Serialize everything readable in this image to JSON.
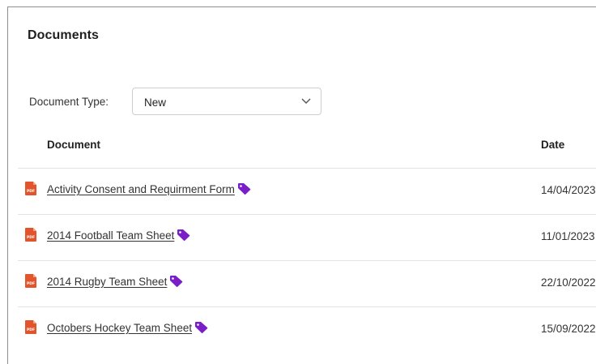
{
  "panel": {
    "title": "Documents"
  },
  "filter": {
    "label": "Document Type:",
    "selected": "New"
  },
  "table": {
    "headers": {
      "document": "Document",
      "date": "Date"
    },
    "rows": [
      {
        "name": "Activity Consent and Requirment Form",
        "date": "14/04/2023"
      },
      {
        "name": "2014 Football Team Sheet",
        "date": "11/01/2023"
      },
      {
        "name": "2014 Rugby Team Sheet",
        "date": "22/10/2022"
      },
      {
        "name": "Octobers Hockey Team Sheet",
        "date": "15/09/2022"
      }
    ]
  },
  "icons": {
    "file": "pdf-file-icon",
    "tag": "tag-icon",
    "dropdown": "chevron-down-icon"
  },
  "colors": {
    "pdf": "#e2552c",
    "tag": "#7a1fc7",
    "link": "#333333",
    "divider": "#e3e3e3"
  }
}
